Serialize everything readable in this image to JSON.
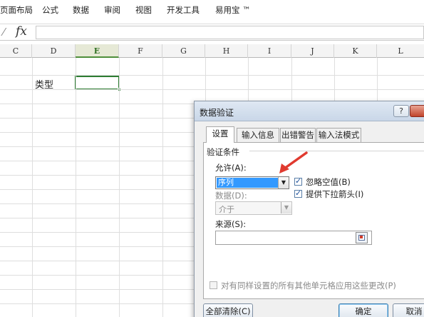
{
  "ribbon": {
    "tabs": [
      "页面布局",
      "公式",
      "数据",
      "审阅",
      "视图",
      "开发工具",
      "易用宝 ™"
    ]
  },
  "formula_bar": {
    "fx_symbol": "fx",
    "value": ""
  },
  "sheet": {
    "columns": [
      "C",
      "D",
      "E",
      "F",
      "G",
      "H",
      "I",
      "J",
      "K",
      "L"
    ],
    "selected_column": "E",
    "cell_text": "类型"
  },
  "dialog": {
    "title": "数据验证",
    "help_label": "?",
    "tabs": [
      "设置",
      "输入信息",
      "出错警告",
      "输入法模式"
    ],
    "active_tab": "设置",
    "group_label": "验证条件",
    "allow_label": "允许(A):",
    "allow_value": "序列",
    "ignore_blank_label": "忽略空值(B)",
    "ignore_blank_checked": true,
    "dropdown_label": "提供下拉箭头(I)",
    "dropdown_checked": true,
    "data_label": "数据(D):",
    "data_value": "介于",
    "source_label": "来源(S):",
    "source_value": "",
    "apply_all_label": "对有同样设置的所有其他单元格应用这些更改(P)",
    "apply_all_checked": false,
    "clear_all_label": "全部清除(C)",
    "ok_label": "确定",
    "cancel_label": "取消"
  },
  "colors": {
    "selection_green": "#2e7d32",
    "selected_item_blue": "#3399ff",
    "annotation_arrow_red": "#e03a2f"
  }
}
